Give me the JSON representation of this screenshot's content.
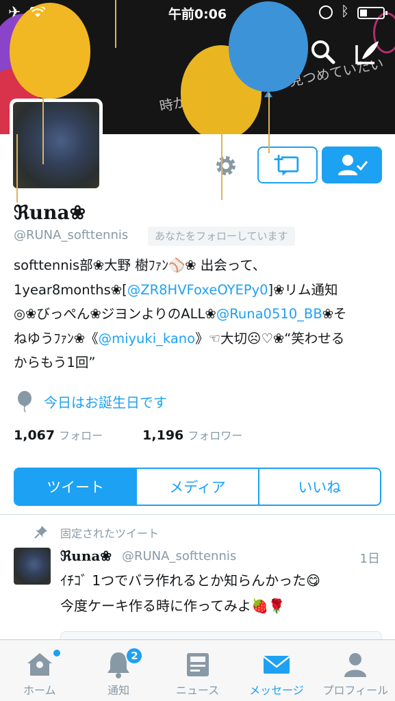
{
  "status_bar": {
    "time": "午前0:06",
    "icons": [
      "airplane-icon",
      "wifi-icon",
      "rotation-lock-icon",
      "bluetooth-icon",
      "battery-icon"
    ]
  },
  "header": {
    "banner_text": "時が止まるなら2人で見つめていたい",
    "icons": [
      "search-icon",
      "compose-icon"
    ]
  },
  "profile": {
    "display_name": "ℜuna❀",
    "handle": "@RUNA_softtennis",
    "follows_you": "あなたをフォローしています",
    "bio_lines": [
      [
        {
          "t": "softtennis部❀大野 樹ﾌｧﾝ⚾❀ 出会って、",
          "link": false
        }
      ],
      [
        {
          "t": "1year8months❀[",
          "link": false
        },
        {
          "t": "@ZR8HVFoxeOYEPy0",
          "link": true
        },
        {
          "t": "]❀リム通知",
          "link": false
        }
      ],
      [
        {
          "t": "◎❀びっぺん❀ジヨンよりのALL❀",
          "link": false
        },
        {
          "t": "@Runa0510_BB",
          "link": true
        },
        {
          "t": "❀そ",
          "link": false
        }
      ],
      [
        {
          "t": "ねゆうﾌｧﾝ❀《",
          "link": false
        },
        {
          "t": "@miyuki_kano",
          "link": true
        },
        {
          "t": "》☜大切☹♡❀“笑わせる",
          "link": false
        }
      ],
      [
        {
          "t": "からもう1回”",
          "link": false
        }
      ]
    ],
    "birthday": "今日はお誕生日です",
    "following_count": "1,067",
    "following_label": "フォロー",
    "followers_count": "1,196",
    "followers_label": "フォロワー"
  },
  "actions": {
    "icons": [
      "gear-icon",
      "add-to-list-icon",
      "following-user-icon"
    ]
  },
  "tabs": [
    {
      "label": "ツイート",
      "active": true
    },
    {
      "label": "メディア",
      "active": false
    },
    {
      "label": "いいね",
      "active": false
    }
  ],
  "pinned_tweet": {
    "label": "固定されたツイート",
    "name": "ℜuna❀",
    "handle": "@RUNA_softtennis",
    "time": "1日",
    "text_lines": [
      "ｲﾁｺﾞ 1つでバラ作れるとか知らんかった😋",
      "今度ケーキ作る時に作ってみよ🍓🌹"
    ]
  },
  "tab_bar": [
    {
      "label": "ホーム",
      "icon": "home-icon",
      "active": false
    },
    {
      "label": "通知",
      "icon": "bell-icon",
      "active": false,
      "badge": "2"
    },
    {
      "label": "ニュース",
      "icon": "news-icon",
      "active": false
    },
    {
      "label": "メッセージ",
      "icon": "envelope-icon",
      "active": true
    },
    {
      "label": "プロフィール",
      "icon": "person-icon",
      "active": false
    }
  ],
  "colors": {
    "accent": "#1da1f2",
    "text": "#14171a",
    "muted": "#8899a6",
    "banner": "#151515"
  }
}
